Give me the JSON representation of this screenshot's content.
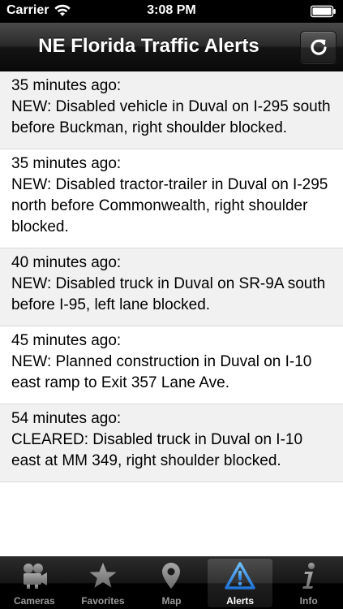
{
  "status_bar": {
    "carrier": "Carrier",
    "time": "3:08 PM",
    "wifi_icon": "wifi-icon",
    "battery_icon": "battery-icon"
  },
  "nav_bar": {
    "title": "NE Florida Traffic Alerts",
    "refresh_icon": "refresh-icon"
  },
  "alerts": [
    {
      "time": "35 minutes ago:",
      "message": "NEW: Disabled vehicle in Duval on I-295 south before Buckman, right shoulder blocked."
    },
    {
      "time": "35 minutes ago:",
      "message": "NEW: Disabled tractor-trailer in Duval on I-295 north before Commonwealth, right shoulder blocked."
    },
    {
      "time": "40 minutes ago:",
      "message": "NEW: Disabled truck in Duval on SR-9A south before I-95, left lane blocked."
    },
    {
      "time": "45 minutes ago:",
      "message": "NEW: Planned construction in Duval on I-10 east ramp to Exit 357 Lane Ave."
    },
    {
      "time": "54 minutes ago:",
      "message": "CLEARED: Disabled truck in Duval on I-10 east at MM 349, right shoulder blocked."
    }
  ],
  "tabs": [
    {
      "label": "Cameras",
      "icon": "movie-camera-icon",
      "active": false
    },
    {
      "label": "Favorites",
      "icon": "star-icon",
      "active": false
    },
    {
      "label": "Map",
      "icon": "map-pin-icon",
      "active": false
    },
    {
      "label": "Alerts",
      "icon": "warning-icon",
      "active": true
    },
    {
      "label": "Info",
      "icon": "info-icon",
      "active": false
    }
  ],
  "colors": {
    "active_tab_label": "#ffffff",
    "inactive_tab_label": "#9a9a9a",
    "alert_icon_blue": "#2f8be6",
    "row_shaded": "#f1f1f1"
  }
}
